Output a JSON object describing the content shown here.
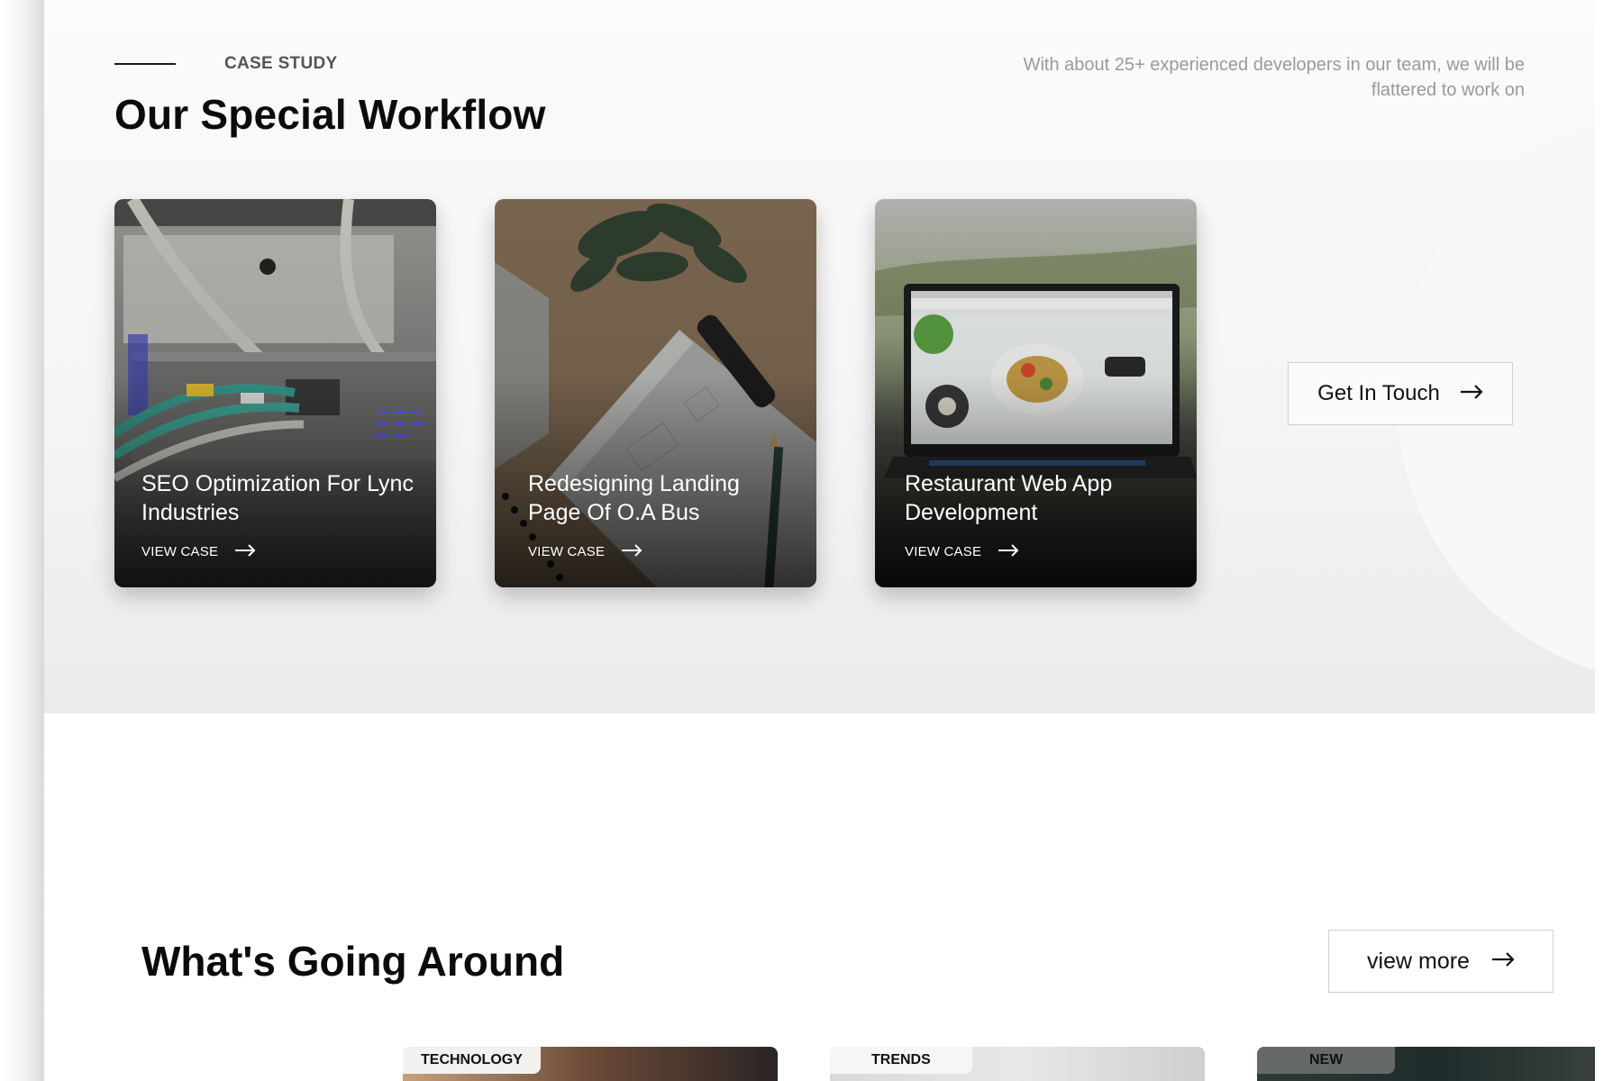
{
  "case_study": {
    "eyebrow": "CASE STUDY",
    "title": "Our Special Workflow",
    "intro": "With about  25+ experienced developers in our team, we will be flattered to work on",
    "cards": [
      {
        "title": "SEO Optimization For Lync Industries",
        "link": "VIEW CASE",
        "image": "network-switch-photo"
      },
      {
        "title": "Redesigning Landing Page Of O.A Bus",
        "link": "VIEW CASE",
        "image": "notebook-plant-photo"
      },
      {
        "title": "Restaurant Web App Development",
        "link": "VIEW CASE",
        "image": "laptop-food-photo"
      }
    ],
    "cta_label": "Get In Touch"
  },
  "news": {
    "title": "What's Going Around",
    "more_label": "view more",
    "cards": [
      {
        "tag": "TECHNOLOGY"
      },
      {
        "tag": "TRENDS"
      },
      {
        "tag": "NEW"
      }
    ]
  },
  "icons": {
    "arrow": "arrow-right-icon"
  },
  "colors": {
    "heading": "#0b0b0b",
    "muted": "#9a9a9a",
    "section_bg": "#f5f5f5"
  }
}
